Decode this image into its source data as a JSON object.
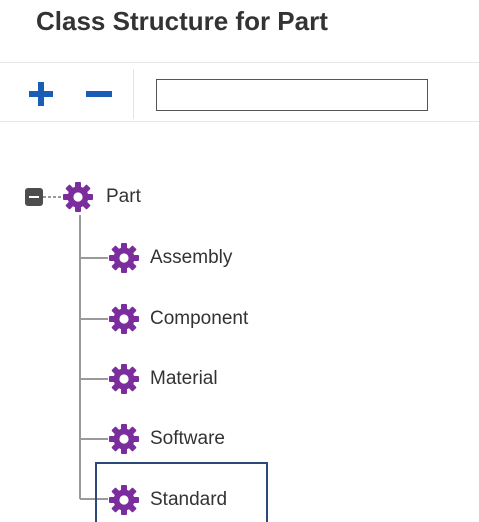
{
  "header": {
    "title": "Class Structure for Part"
  },
  "toolbar": {
    "add_icon": "plus-icon",
    "remove_icon": "minus-icon",
    "search": {
      "value": "",
      "placeholder": ""
    }
  },
  "tree": {
    "root": {
      "label": "Part",
      "icon": "gear-icon",
      "expanded": true
    },
    "children": [
      {
        "label": "Assembly",
        "icon": "gear-icon"
      },
      {
        "label": "Component",
        "icon": "gear-icon"
      },
      {
        "label": "Material",
        "icon": "gear-icon"
      },
      {
        "label": "Software",
        "icon": "gear-icon"
      },
      {
        "label": "Standard",
        "icon": "gear-icon",
        "selected": true
      }
    ]
  },
  "colors": {
    "accent_blue": "#1a5db5",
    "gear_purple": "#7b2d9e",
    "title_text": "#333333",
    "selection_border": "#2b4a7a"
  }
}
